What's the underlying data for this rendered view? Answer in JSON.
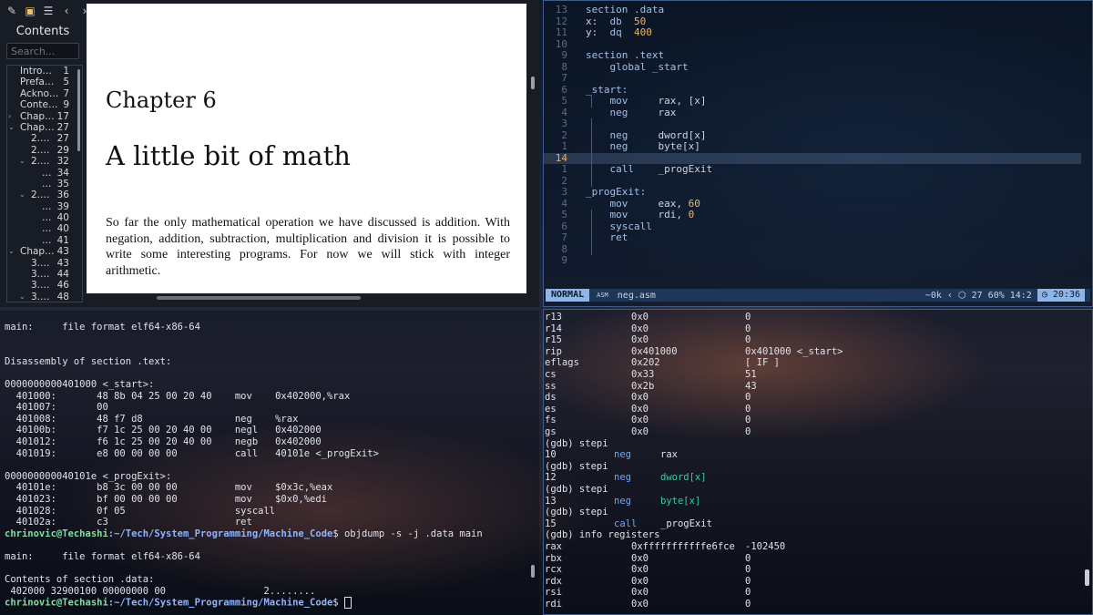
{
  "pdf_viewer": {
    "toc_title": "Contents",
    "search_placeholder": "Search...",
    "toc_items": [
      {
        "indent": 0,
        "chev": "",
        "label": "Intro…",
        "page": "1"
      },
      {
        "indent": 0,
        "chev": "",
        "label": "Prefa…",
        "page": "5"
      },
      {
        "indent": 0,
        "chev": "",
        "label": "Ackno…",
        "page": "7"
      },
      {
        "indent": 0,
        "chev": "",
        "label": "Conte…",
        "page": "9"
      },
      {
        "indent": 0,
        "chev": "›",
        "label": "Chap…",
        "page": "17"
      },
      {
        "indent": 0,
        "chev": "⌄",
        "label": "Chap…",
        "page": "27"
      },
      {
        "indent": 1,
        "chev": "",
        "label": "2.…",
        "page": "27"
      },
      {
        "indent": 1,
        "chev": "",
        "label": "2.…",
        "page": "29"
      },
      {
        "indent": 1,
        "chev": "⌄",
        "label": "2.…",
        "page": "32"
      },
      {
        "indent": 2,
        "chev": "",
        "label": "…",
        "page": "34"
      },
      {
        "indent": 2,
        "chev": "",
        "label": "…",
        "page": "35"
      },
      {
        "indent": 1,
        "chev": "⌄",
        "label": "2.…",
        "page": "36"
      },
      {
        "indent": 2,
        "chev": "",
        "label": "…",
        "page": "39"
      },
      {
        "indent": 2,
        "chev": "",
        "label": "…",
        "page": "40"
      },
      {
        "indent": 2,
        "chev": "",
        "label": "…",
        "page": "40"
      },
      {
        "indent": 2,
        "chev": "",
        "label": "…",
        "page": "41"
      },
      {
        "indent": 0,
        "chev": "⌄",
        "label": "Chap…",
        "page": "43"
      },
      {
        "indent": 1,
        "chev": "",
        "label": "3.…",
        "page": "43"
      },
      {
        "indent": 1,
        "chev": "",
        "label": "3.…",
        "page": "44"
      },
      {
        "indent": 1,
        "chev": "",
        "label": "3.…",
        "page": "46"
      },
      {
        "indent": 1,
        "chev": "⌄",
        "label": "3.…",
        "page": "48"
      }
    ],
    "chapter_label": "Chapter 6",
    "chapter_title": "A little bit of math",
    "chapter_body": "So far the only mathematical operation we have discussed is addition. With negation, addition, subtraction, multiplication and division it is possible to write some interesting programs. For now we will stick with integer arithmetic."
  },
  "editor": {
    "lines": [
      {
        "n": "13",
        "segs": [
          [
            "kw",
            "section .data"
          ]
        ]
      },
      {
        "n": "12",
        "segs": [
          [
            "plain",
            "x:  "
          ],
          [
            "kw",
            "db"
          ],
          [
            "plain",
            "  "
          ],
          [
            "num",
            "50"
          ]
        ]
      },
      {
        "n": "11",
        "segs": [
          [
            "plain",
            "y:  "
          ],
          [
            "kw",
            "dq"
          ],
          [
            "plain",
            "  "
          ],
          [
            "num",
            "400"
          ]
        ]
      },
      {
        "n": "10",
        "segs": []
      },
      {
        "n": "9",
        "segs": [
          [
            "kw",
            "section .text"
          ]
        ]
      },
      {
        "n": "8",
        "segs": [
          [
            "plain",
            "    "
          ],
          [
            "kw",
            "global _start"
          ]
        ]
      },
      {
        "n": "7",
        "segs": []
      },
      {
        "n": "6",
        "segs": [
          [
            "kw",
            "_start:"
          ]
        ]
      },
      {
        "n": "5",
        "segs": [
          [
            "plain",
            "    "
          ],
          [
            "kw",
            "mov"
          ],
          [
            "plain",
            "     rax, [x]"
          ]
        ]
      },
      {
        "n": "4",
        "segs": [
          [
            "plain",
            "    "
          ],
          [
            "kw",
            "neg"
          ],
          [
            "plain",
            "     rax"
          ]
        ]
      },
      {
        "n": "3",
        "segs": []
      },
      {
        "n": "2",
        "segs": [
          [
            "plain",
            "    "
          ],
          [
            "kw",
            "neg"
          ],
          [
            "plain",
            "     dword[x]"
          ]
        ]
      },
      {
        "n": "1",
        "segs": [
          [
            "plain",
            "    "
          ],
          [
            "kw",
            "neg"
          ],
          [
            "plain",
            "     byte[x]"
          ]
        ]
      },
      {
        "n": "14",
        "segs": [],
        "cursor": true
      },
      {
        "n": "1",
        "segs": [
          [
            "plain",
            "    "
          ],
          [
            "kw",
            "call"
          ],
          [
            "plain",
            "    _progExit"
          ]
        ]
      },
      {
        "n": "2",
        "segs": []
      },
      {
        "n": "3",
        "segs": [
          [
            "kw",
            "_progExit:"
          ]
        ]
      },
      {
        "n": "4",
        "segs": [
          [
            "plain",
            "    "
          ],
          [
            "kw",
            "mov"
          ],
          [
            "plain",
            "     eax, "
          ],
          [
            "num",
            "60"
          ]
        ]
      },
      {
        "n": "5",
        "segs": [
          [
            "plain",
            "    "
          ],
          [
            "kw",
            "mov"
          ],
          [
            "plain",
            "     rdi, "
          ],
          [
            "num",
            "0"
          ]
        ]
      },
      {
        "n": "6",
        "segs": [
          [
            "plain",
            "    "
          ],
          [
            "kw",
            "syscall"
          ]
        ]
      },
      {
        "n": "7",
        "segs": [
          [
            "plain",
            "    "
          ],
          [
            "kw",
            "ret"
          ]
        ]
      },
      {
        "n": "8",
        "segs": []
      },
      {
        "n": "9",
        "segs": []
      }
    ],
    "status": {
      "mode": "NORMAL",
      "filetype": "ASM",
      "filename": "neg.asm",
      "size": "~0k",
      "lines": "27",
      "percent": "60%",
      "position": "14:2",
      "time": "20:36"
    }
  },
  "objdump_terminal": {
    "lines": [
      "main:     file format elf64-x86-64",
      "",
      "",
      "Disassembly of section .text:",
      "",
      "0000000000401000 <_start>:",
      "  401000:       48 8b 04 25 00 20 40    mov    0x402000,%rax",
      "  401007:       00",
      "  401008:       48 f7 d8                neg    %rax",
      "  40100b:       f7 1c 25 00 20 40 00    negl   0x402000",
      "  401012:       f6 1c 25 00 20 40 00    negb   0x402000",
      "  401019:       e8 00 00 00 00          call   40101e <_progExit>",
      "",
      "000000000040101e <_progExit>:",
      "  40101e:       b8 3c 00 00 00          mov    $0x3c,%eax",
      "  401023:       bf 00 00 00 00          mov    $0x0,%edi",
      "  401028:       0f 05                   syscall",
      "  40102a:       c3                      ret"
    ],
    "prompt_user": "chrinovic@Techashi",
    "prompt_path": ":~/Tech/System_Programming/Machine_Code",
    "command": "$ objdump -s -j .data main",
    "lines2": [
      "",
      "main:     file format elf64-x86-64",
      "",
      "Contents of section .data:",
      " 402000 32900100 00000000 00                 2........"
    ],
    "prompt_end": "$ "
  },
  "gdb_terminal": {
    "lines": [
      {
        "t": "reg",
        "c": [
          "r13",
          "0x0",
          "0"
        ]
      },
      {
        "t": "reg",
        "c": [
          "r14",
          "0x0",
          "0"
        ]
      },
      {
        "t": "reg",
        "c": [
          "r15",
          "0x0",
          "0"
        ]
      },
      {
        "t": "reg",
        "c": [
          "rip",
          "0x401000",
          "0x401000 <_start>"
        ]
      },
      {
        "t": "reg",
        "c": [
          "eflags",
          "0x202",
          "[ IF ]"
        ]
      },
      {
        "t": "reg",
        "c": [
          "cs",
          "0x33",
          "51"
        ]
      },
      {
        "t": "reg",
        "c": [
          "ss",
          "0x2b",
          "43"
        ]
      },
      {
        "t": "reg",
        "c": [
          "ds",
          "0x0",
          "0"
        ]
      },
      {
        "t": "reg",
        "c": [
          "es",
          "0x0",
          "0"
        ]
      },
      {
        "t": "reg",
        "c": [
          "fs",
          "0x0",
          "0"
        ]
      },
      {
        "t": "reg",
        "c": [
          "gs",
          "0x0",
          "0"
        ]
      },
      {
        "t": "text",
        "v": "(gdb) stepi"
      },
      {
        "t": "asm",
        "ln": "10",
        "mn": "neg",
        "op": "rax",
        "opc": "plain"
      },
      {
        "t": "text",
        "v": "(gdb) stepi"
      },
      {
        "t": "asm",
        "ln": "12",
        "mn": "neg",
        "op": "dword[x]",
        "opc": "op"
      },
      {
        "t": "text",
        "v": "(gdb) stepi"
      },
      {
        "t": "asm",
        "ln": "13",
        "mn": "neg",
        "op": "byte[x]",
        "opc": "op"
      },
      {
        "t": "text",
        "v": "(gdb) stepi"
      },
      {
        "t": "asm",
        "ln": "15",
        "mn": "call",
        "op": "_progExit",
        "opc": "plain"
      },
      {
        "t": "text",
        "v": "(gdb) info registers"
      },
      {
        "t": "reg",
        "c": [
          "rax",
          "0xfffffffffffe6fce",
          "-102450"
        ]
      },
      {
        "t": "reg",
        "c": [
          "rbx",
          "0x0",
          "0"
        ]
      },
      {
        "t": "reg",
        "c": [
          "rcx",
          "0x0",
          "0"
        ]
      },
      {
        "t": "reg",
        "c": [
          "rdx",
          "0x0",
          "0"
        ]
      },
      {
        "t": "reg",
        "c": [
          "rsi",
          "0x0",
          "0"
        ]
      },
      {
        "t": "reg",
        "c": [
          "rdi",
          "0x0",
          "0"
        ]
      }
    ]
  }
}
